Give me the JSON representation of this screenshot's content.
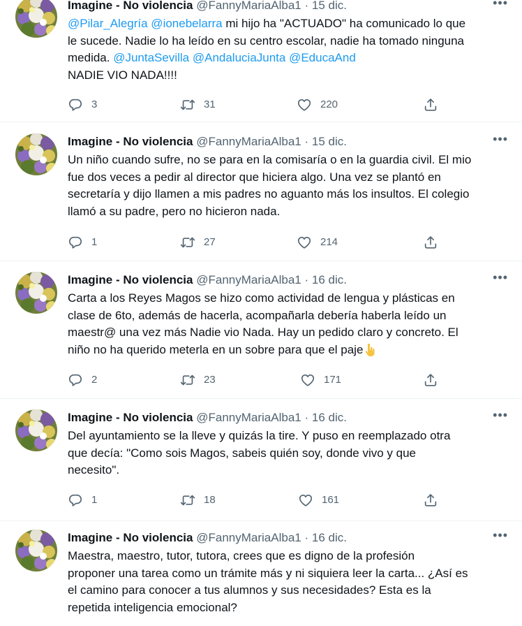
{
  "author": {
    "name": "Imagine - No violencia",
    "handle": "@FannyMariaAlba1"
  },
  "separator": "·",
  "tweets": [
    {
      "date": "15 dic.",
      "mentions_line1": "@Pilar_Alegría @ionebelarra",
      "text_line1": " mi hijo ha \"ACTUADO\" ha comunicado lo que",
      "text_line2": "le sucede. Nadie lo ha leído en su centro escolar, nadie ha tomado ninguna",
      "text_line3_plain": "medida. ",
      "mentions_line3": "@JuntaSevilla @AndaluciaJunta @EducaAnd",
      "text_line4": "NADIE VIO NADA!!!!",
      "replies": "3",
      "retweets": "31",
      "likes": "220"
    },
    {
      "date": "15 dic.",
      "lines": [
        "Un niño cuando sufre, no se para en la comisaría o en la guardia civil. El mio",
        "fue dos veces a pedir al director que hiciera algo. Una vez se plantó en",
        "secretaría y dijo llamen a mis padres no aguanto más los insultos. El colegio",
        "llamó a su padre, pero no hicieron nada."
      ],
      "replies": "1",
      "retweets": "27",
      "likes": "214"
    },
    {
      "date": "16 dic.",
      "lines": [
        "Carta a los Reyes Magos se hizo como actividad de lengua y plásticas en",
        "clase de 6to, además de hacerla, acompañarla debería haberla leído un",
        "maestr@ una vez más Nadie vio Nada. Hay un pedido claro y concreto. El",
        "niño no ha querido meterla en un sobre para que el paje"
      ],
      "emoji": "pointing-down-hand-icon",
      "replies": "2",
      "retweets": "23",
      "likes": "171"
    },
    {
      "date": "16 dic.",
      "lines": [
        "Del ayuntamiento se la lleve y quizás la tire. Y puso en reemplazado otra",
        "que decía: \"Como sois Magos, sabeis quién soy, donde vivo y que",
        "necesito\"."
      ],
      "replies": "1",
      "retweets": "18",
      "likes": "161"
    },
    {
      "date": "16 dic.",
      "lines": [
        "Maestra, maestro, tutor, tutora, crees que es digno de la profesión",
        "proponer una tarea como un trámite más y ni siquiera leer la carta... ¿Así es",
        "el camino para conocer a tus alumnos y sus necesidades? Esta es la",
        "repetida inteligencia emocional?"
      ]
    }
  ],
  "icons": {
    "reply": "reply-icon",
    "retweet": "retweet-icon",
    "like": "heart-icon",
    "share": "share-icon",
    "more": "more-dots-icon",
    "avatar": "avatar-flowers"
  },
  "colors": {
    "text": "#0f1419",
    "muted": "#536471",
    "link": "#1d9bf0"
  }
}
